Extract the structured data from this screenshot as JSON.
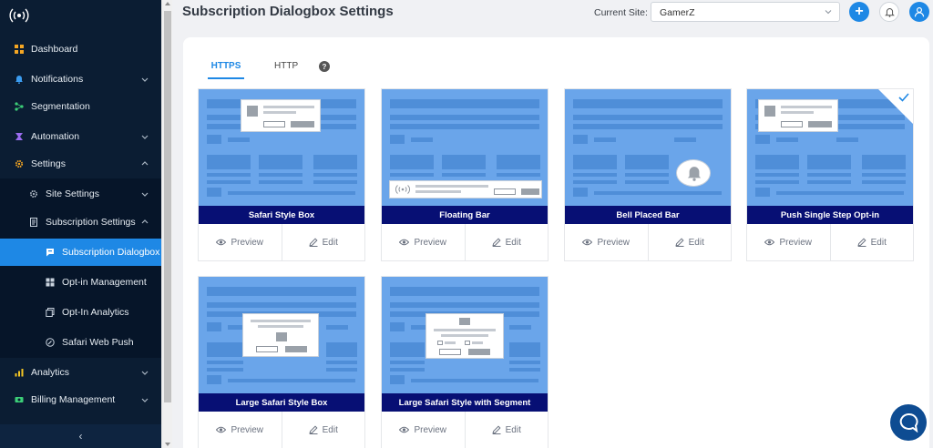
{
  "sidebar": {
    "items": [
      {
        "label": "Dashboard",
        "icon": "dashboard-icon"
      },
      {
        "label": "Notifications",
        "icon": "bell-icon"
      },
      {
        "label": "Segmentation",
        "icon": "segmentation-icon"
      },
      {
        "label": "Automation",
        "icon": "automation-icon"
      },
      {
        "label": "Settings",
        "icon": "gear-icon"
      },
      {
        "label": "Site Settings",
        "icon": "gear-icon"
      },
      {
        "label": "Subscription Settings",
        "icon": "document-icon"
      },
      {
        "label": "Subscription Dialogbox",
        "icon": "dialog-icon"
      },
      {
        "label": "Opt-in Management",
        "icon": "grid-icon"
      },
      {
        "label": "Opt-In Analytics",
        "icon": "copy-icon"
      },
      {
        "label": "Safari Web Push",
        "icon": "compass-icon"
      },
      {
        "label": "Analytics",
        "icon": "chart-icon"
      },
      {
        "label": "Billing Management",
        "icon": "money-icon"
      }
    ],
    "collapse_glyph": "‹"
  },
  "header": {
    "title": "Subscription Dialogbox Settings",
    "site_label": "Current Site:",
    "site_value": "GamerZ",
    "add_glyph": "+"
  },
  "tabs": [
    {
      "label": "HTTPS",
      "active": true
    },
    {
      "label": "HTTP",
      "active": false
    }
  ],
  "help_glyph": "?",
  "templates": [
    {
      "caption": "Safari Style Box",
      "preview": "Preview",
      "edit": "Edit",
      "selected": false
    },
    {
      "caption": "Floating Bar",
      "preview": "Preview",
      "edit": "Edit",
      "selected": false
    },
    {
      "caption": "Bell Placed Bar",
      "preview": "Preview",
      "edit": "Edit",
      "selected": false
    },
    {
      "caption": "Push Single Step Opt-in",
      "preview": "Preview",
      "edit": "Edit",
      "selected": true
    },
    {
      "caption": "Large Safari Style Box",
      "preview": "Preview",
      "edit": "Edit",
      "selected": false
    },
    {
      "caption": "Large Safari Style with Segment",
      "preview": "Preview",
      "edit": "Edit",
      "selected": false
    }
  ],
  "colors": {
    "sidebar_bg": "#0b1d33",
    "accent": "#1e88e5",
    "caption_bg": "#070f74",
    "thumb_bg": "#6aa5ea"
  }
}
